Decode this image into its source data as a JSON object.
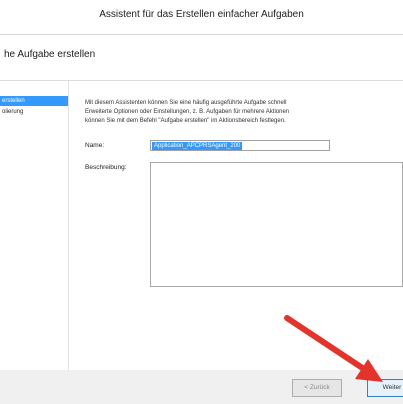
{
  "window": {
    "title": "Assistent für das Erstellen einfacher Aufgaben"
  },
  "header": {
    "page_title": "he Aufgabe erstellen"
  },
  "sidebar": {
    "items": [
      {
        "label": "erstellen",
        "active": true
      },
      {
        "label": "olierung",
        "active": false
      }
    ]
  },
  "main": {
    "description_lines": [
      "Mit diesem Assistenten können Sie eine häufig ausgeführte Aufgabe schnell",
      "Erweiterte Optionen oder Einstellungen, z. B. Aufgaben für mehrere Aktionen",
      "können Sie mit dem Befehl \"Aufgabe erstellen\" im Aktionsbereich festlegen."
    ],
    "name_label": "Name:",
    "name_value": "Application_APCPRSAgent_200",
    "description_label": "Beschreibung:",
    "description_value": ""
  },
  "footer": {
    "back_label": "< Zurück",
    "next_label": "Weiter"
  },
  "colors": {
    "selection": "#3399ff",
    "arrow": "#e3332b"
  },
  "annotations": {
    "arrow_icon": "red-arrow-icon"
  }
}
